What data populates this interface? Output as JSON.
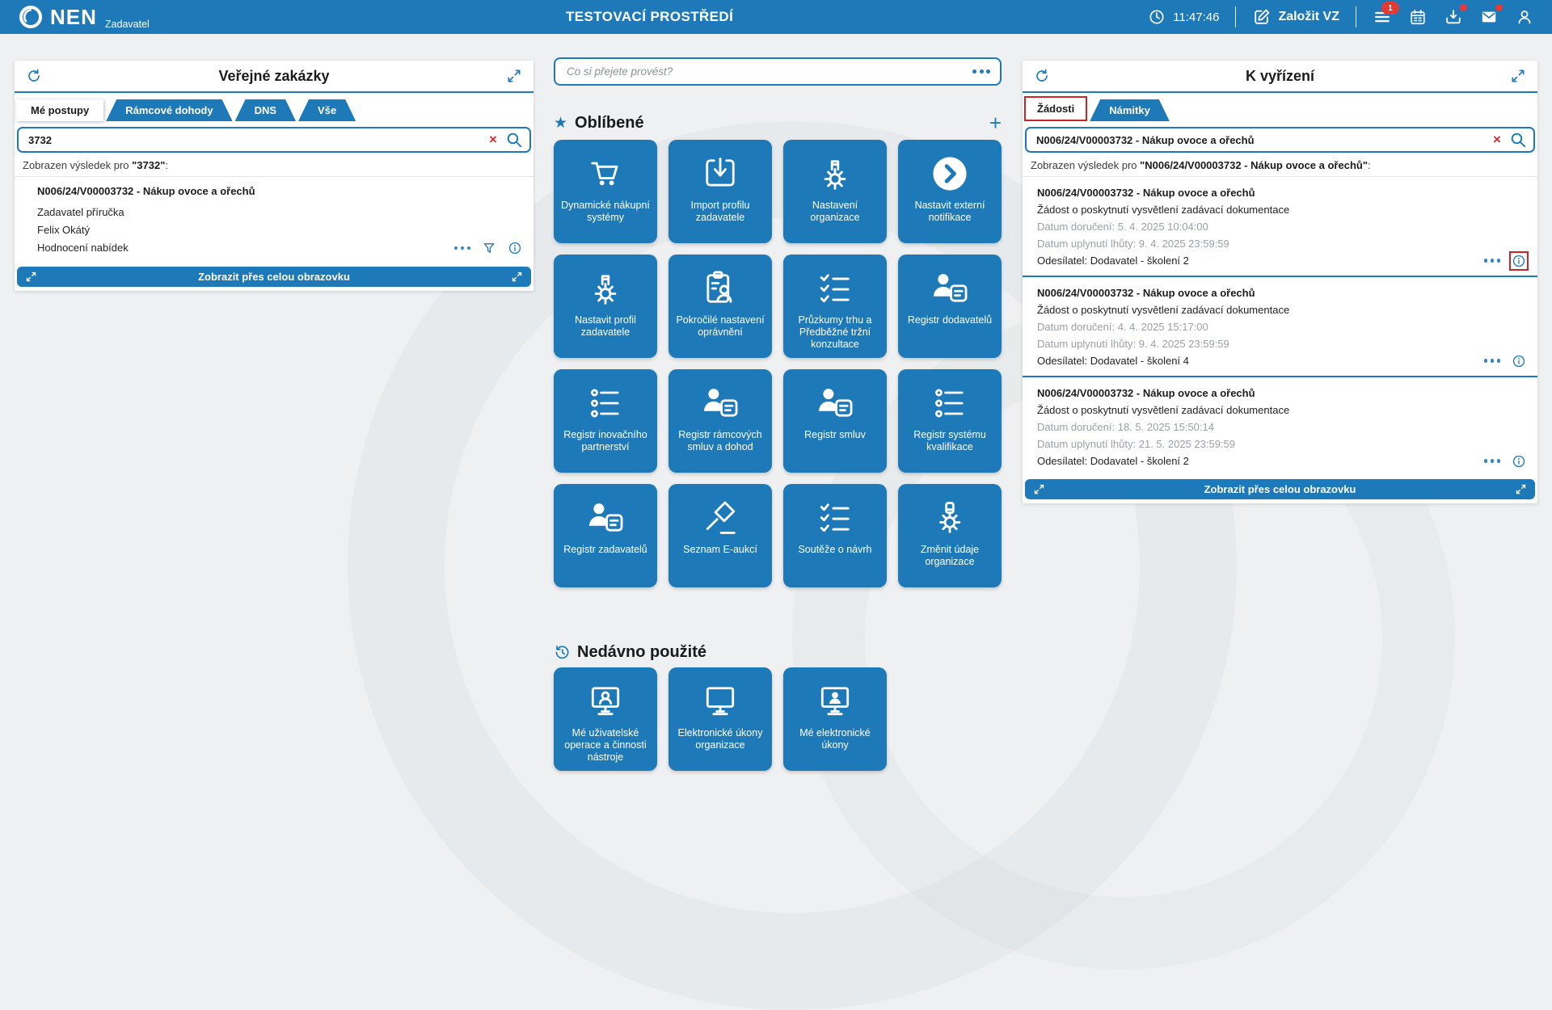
{
  "colors": {
    "primary": "#1E79B8",
    "badge": "#E53935",
    "danger": "#D32F2F",
    "annotation": "#C62828",
    "bg": "#EEF0F1",
    "muted_text": "#9AA0A6"
  },
  "glyphs": {
    "star": "★",
    "plus": "+",
    "close": "×"
  },
  "header": {
    "brand": "NEN",
    "brand_sub": "Zadavatel",
    "env_title": "TESTOVACÍ PROSTŘEDÍ",
    "time": "11:47:46",
    "create_vz_label": "Založit VZ",
    "menu_badge": "1"
  },
  "left_panel": {
    "title": "Veřejné zakázky",
    "tabs": [
      {
        "label": "Mé postupy",
        "active": true
      },
      {
        "label": "Rámcové dohody",
        "active": false
      },
      {
        "label": "DNS",
        "active": false
      },
      {
        "label": "Vše",
        "active": false
      }
    ],
    "search_value": "3732",
    "result_prefix": "Zobrazen výsledek pro ",
    "result_query": "\"3732\"",
    "result_suffix": ":",
    "result": {
      "title": "N006/24/V00003732 - Nákup ovoce a ořechů",
      "line2": "Zadavatel příručka",
      "line3": "Felix Okátý",
      "line4": "Hodnocení nabídek"
    },
    "fullscreen_label": "Zobrazit přes celou obrazovku"
  },
  "assistant": {
    "placeholder": "Co si přejete provést?"
  },
  "favorites": {
    "title": "Oblíbené",
    "tiles": [
      {
        "name": "dynamic-purchasing-systems",
        "icon": "cart",
        "label": "Dynamické nákupní systémy"
      },
      {
        "name": "import-contracting-authority-profile",
        "icon": "import",
        "label": "Import profilu zadavatele"
      },
      {
        "name": "organization-settings",
        "icon": "gear-building",
        "label": "Nastavení organizace"
      },
      {
        "name": "set-external-notifications",
        "icon": "chevron-circle",
        "label": "Nastavit externí notifikace"
      },
      {
        "name": "set-contracting-authority-profile",
        "icon": "gear-building",
        "label": "Nastavit profil zadavatele"
      },
      {
        "name": "advanced-permission-settings",
        "icon": "clipboard-person",
        "label": "Pokročilé nastavení oprávnění"
      },
      {
        "name": "market-research-preliminary-consultations",
        "icon": "checklist",
        "label": "Průzkumy trhu a Předběžné tržní konzultace"
      },
      {
        "name": "supplier-register",
        "icon": "person-doc",
        "label": "Registr dodavatelů"
      },
      {
        "name": "innovation-partnership-register",
        "icon": "bullet-list",
        "label": "Registr inovačního partnerství"
      },
      {
        "name": "framework-contracts-register",
        "icon": "person-doc",
        "label": "Registr rámcových smluv a dohod"
      },
      {
        "name": "contract-register",
        "icon": "person-doc",
        "label": "Registr smluv"
      },
      {
        "name": "qualification-system-register",
        "icon": "bullet-list",
        "label": "Registr systému kvalifikace"
      },
      {
        "name": "contracting-authority-register",
        "icon": "person-doc",
        "label": "Registr zadavatelů"
      },
      {
        "name": "e-auction-list",
        "icon": "gavel",
        "label": "Seznam E-aukcí"
      },
      {
        "name": "design-contests",
        "icon": "checklist",
        "label": "Soutěže o návrh"
      },
      {
        "name": "change-organization-details",
        "icon": "gear-doc",
        "label": "Změnit údaje organizace"
      }
    ]
  },
  "recent": {
    "title": "Nedávno použité",
    "tiles": [
      {
        "name": "my-user-operations-tools",
        "icon": "monitor-person",
        "label": "Mé uživatelské operace a činnosti nástroje"
      },
      {
        "name": "organization-electronic-acts",
        "icon": "monitor",
        "label": "Elektronické úkony organizace"
      },
      {
        "name": "my-electronic-acts",
        "icon": "monitor-person-filled",
        "label": "Mé elektronické úkony"
      }
    ]
  },
  "right_panel": {
    "title": "K vyřízení",
    "tabs": [
      {
        "label": "Žádosti",
        "active": true,
        "highlighted": true
      },
      {
        "label": "Námitky",
        "active": false
      }
    ],
    "search_value": "N006/24/V00003732 - Nákup ovoce a ořechů",
    "result_prefix": "Zobrazen výsledek pro ",
    "result_query": "\"N006/24/V00003732 - Nákup ovoce a ořechů\"",
    "result_suffix": ":",
    "items": [
      {
        "title": "N006/24/V00003732 - Nákup ovoce a ořechů",
        "subject": "Žádost o poskytnutí vysvětlení zadávací dokumentace",
        "received": "Datum doručení: 5. 4. 2025 10:04:00",
        "deadline": "Datum uplynutí lhůty: 9. 4. 2025 23:59:59",
        "sender": "Odesílatel: Dodavatel - školení 2",
        "info_highlighted": true
      },
      {
        "title": "N006/24/V00003732 - Nákup ovoce a ořechů",
        "subject": "Žádost o poskytnutí vysvětlení zadávací dokumentace",
        "received": "Datum doručení: 4. 4. 2025 15:17:00",
        "deadline": "Datum uplynutí lhůty: 9. 4. 2025 23:59:59",
        "sender": "Odesílatel: Dodavatel - školení 4",
        "info_highlighted": false
      },
      {
        "title": "N006/24/V00003732 - Nákup ovoce a ořechů",
        "subject": "Žádost o poskytnutí vysvětlení zadávací dokumentace",
        "received": "Datum doručení: 18. 5. 2025 15:50:14",
        "deadline": "Datum uplynutí lhůty: 21. 5. 2025 23:59:59",
        "sender": "Odesílatel: Dodavatel - školení 2",
        "info_highlighted": false
      }
    ],
    "fullscreen_label": "Zobrazit přes celou obrazovku"
  }
}
